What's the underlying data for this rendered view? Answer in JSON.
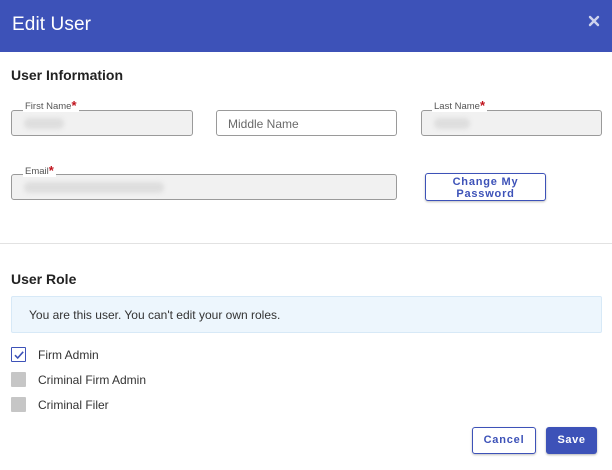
{
  "dialog": {
    "title": "Edit User",
    "close_icon": "close-icon"
  },
  "user_info": {
    "section_title": "User Information",
    "first_name": {
      "label": "First Name",
      "required_mark": "*",
      "value": ""
    },
    "middle_name": {
      "placeholder": "Middle Name",
      "value": ""
    },
    "last_name": {
      "label": "Last Name",
      "required_mark": "*",
      "value": ""
    },
    "email": {
      "label": "Email",
      "required_mark": "*",
      "value": ""
    },
    "change_password_label_line1": "Change My",
    "change_password_label_line2": "Password"
  },
  "user_role": {
    "section_title": "User Role",
    "notice": "You are this user. You can't edit your own roles.",
    "roles": [
      {
        "label": "Firm Admin",
        "checked": true
      },
      {
        "label": "Criminal Firm Admin",
        "checked": false
      },
      {
        "label": "Criminal Filer",
        "checked": false
      }
    ]
  },
  "footer": {
    "cancel_label": "Cancel",
    "save_label": "Save"
  },
  "colors": {
    "accent": "#3d52b8",
    "required": "#c0121c",
    "info_bg": "#edf6fd",
    "disabled_checkbox": "#c6c6c6"
  }
}
